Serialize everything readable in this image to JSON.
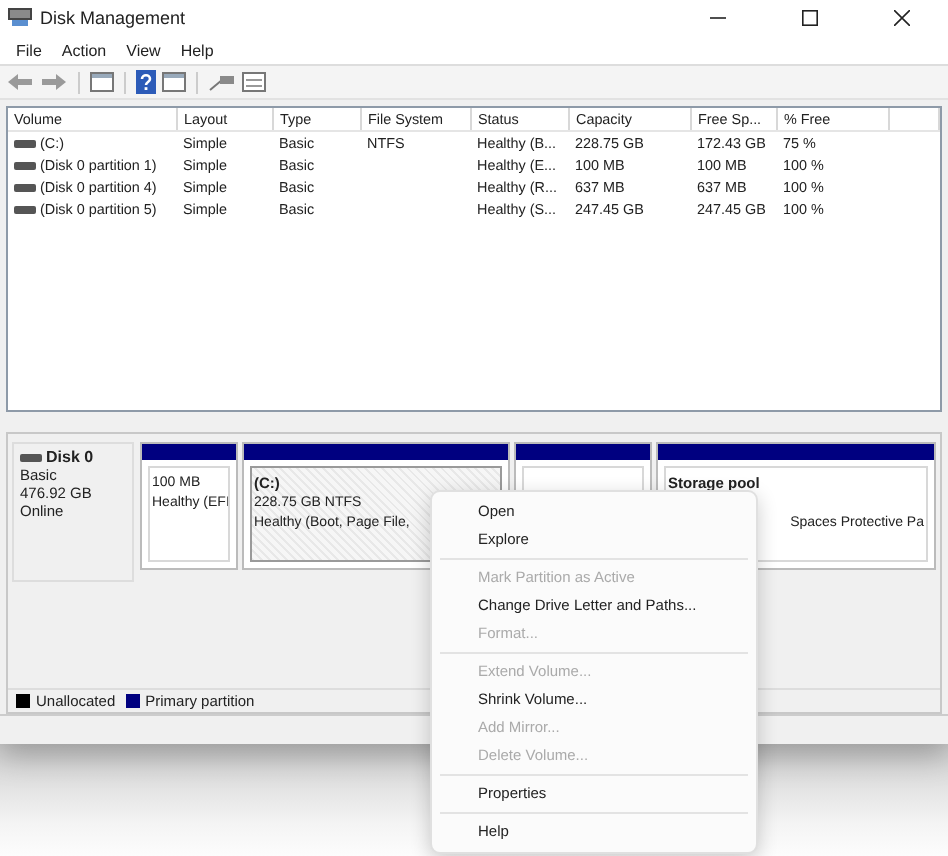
{
  "window": {
    "title": "Disk Management"
  },
  "menu_bar": [
    "File",
    "Action",
    "View",
    "Help"
  ],
  "table": {
    "columns": [
      "Volume",
      "Layout",
      "Type",
      "File System",
      "Status",
      "Capacity",
      "Free Sp...",
      "% Free"
    ],
    "rows": [
      {
        "cells": [
          "(C:)",
          "Simple",
          "Basic",
          "NTFS",
          "Healthy (B...",
          "228.75 GB",
          "172.43 GB",
          "75 %"
        ]
      },
      {
        "cells": [
          "(Disk 0 partition 1)",
          "Simple",
          "Basic",
          "",
          "Healthy (E...",
          "100 MB",
          "100 MB",
          "100 %"
        ]
      },
      {
        "cells": [
          "(Disk 0 partition 4)",
          "Simple",
          "Basic",
          "",
          "Healthy (R...",
          "637 MB",
          "637 MB",
          "100 %"
        ]
      },
      {
        "cells": [
          "(Disk 0 partition 5)",
          "Simple",
          "Basic",
          "",
          "Healthy (S...",
          "247.45 GB",
          "247.45 GB",
          "100 %"
        ]
      }
    ]
  },
  "disk": {
    "name": "Disk 0",
    "lines": [
      "Basic",
      "476.92 GB",
      "Online"
    ],
    "partitions": [
      {
        "lines": [
          "100 MB",
          "Healthy (EFI"
        ],
        "selected": false
      },
      {
        "title": "(C:)",
        "lines": [
          "228.75 GB NTFS",
          "Healthy (Boot, Page File,"
        ],
        "selected": true
      },
      {
        "selected": false
      },
      {
        "title": "Storage pool",
        "lines": [
          "Spaces Protective Pa"
        ],
        "selected": false
      }
    ]
  },
  "legend": [
    {
      "label": "Unallocated",
      "color": "#000000"
    },
    {
      "label": "Primary partition",
      "color": "#000080"
    }
  ],
  "context_menu": [
    {
      "kind": "item",
      "label": "Open",
      "disabled": false
    },
    {
      "kind": "item",
      "label": "Explore",
      "disabled": false
    },
    {
      "kind": "separator"
    },
    {
      "kind": "item",
      "label": "Mark Partition as Active",
      "disabled": true
    },
    {
      "kind": "item",
      "label": "Change Drive Letter and Paths...",
      "disabled": false
    },
    {
      "kind": "item",
      "label": "Format...",
      "disabled": true
    },
    {
      "kind": "separator"
    },
    {
      "kind": "item",
      "label": "Extend Volume...",
      "disabled": true
    },
    {
      "kind": "item",
      "label": "Shrink Volume...",
      "disabled": false
    },
    {
      "kind": "item",
      "label": "Add Mirror...",
      "disabled": true
    },
    {
      "kind": "item",
      "label": "Delete Volume...",
      "disabled": true
    },
    {
      "kind": "separator"
    },
    {
      "kind": "item",
      "label": "Properties",
      "disabled": false
    },
    {
      "kind": "separator"
    },
    {
      "kind": "item",
      "label": "Help",
      "disabled": false
    }
  ]
}
